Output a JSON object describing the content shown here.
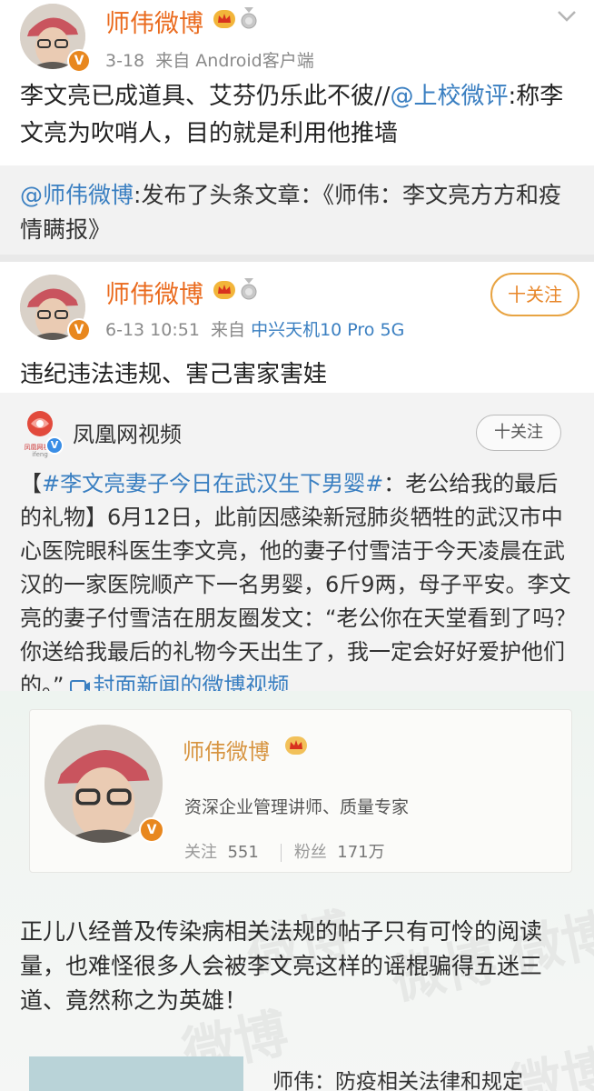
{
  "post1": {
    "author": "师伟微博",
    "time": "3-18",
    "source_prefix": "来自",
    "source": "Android客户端",
    "text_main": "李文亮已成道具、艾芬仍乐此不彼//",
    "mention": "@上校微评",
    "text_after": ":称李文亮为吹哨人，目的就是利用他推墙",
    "repost": {
      "mention": "@师伟微博",
      "text": ":发布了头条文章：《师伟：李文亮方方和疫情瞒报》"
    }
  },
  "post2": {
    "author": "师伟微博",
    "time": "6-13 10:51",
    "source_prefix": "来自",
    "source": "中兴天机10 Pro 5G",
    "follow_label": "十关注",
    "text": "违纪违法违规、害己害家害娃"
  },
  "video_card": {
    "account": "凤凰网视频",
    "logo_text": "凤凰网视频",
    "logo_sub": "ifeng",
    "follow_label": "十关注",
    "text_open": "【",
    "hashtag": "#李文亮妻子今日在武汉生下男婴#",
    "text_body": "：老公给我的最后的礼物】6月12日，此前因感染新冠肺炎牺牲的武汉市中心医院眼科医生李文亮，他的妻子付雪洁于今天凌晨在武汉的一家医院顺产下一名男婴，6斤9两，母子平安。李文亮的妻子付雪洁在朋友圈发文：“老公你在天堂看到了吗？你送给我最后的礼物今天出生了，我一定会好好爱护他们的。”",
    "video_link": "封面新闻的微博视频"
  },
  "screenshot": {
    "profile_name": "师伟微博",
    "profile_desc": "资深企业管理讲师、质量专家",
    "follow_label": "关注",
    "follow_count": "551",
    "fans_label": "粉丝",
    "fans_count": "171万",
    "body": "正儿八经普及传染病相关法规的帖子只有可怜的阅读量，也难怪很多人会被李文亮这样的谣棍骗得五迷三道、竟然称之为英雄！",
    "article_title": "师伟：防疫相关法律和规定",
    "watermark": "微博"
  },
  "icons": {
    "verified": "verified-badge-icon",
    "crown": "crown-icon",
    "medal": "medal-icon",
    "chevron": "chevron-down-icon",
    "video": "video-link-icon"
  },
  "colors": {
    "name_orange": "#ea6a1d",
    "link_blue": "#3a7fc1",
    "follow_orange": "#e8872a"
  }
}
